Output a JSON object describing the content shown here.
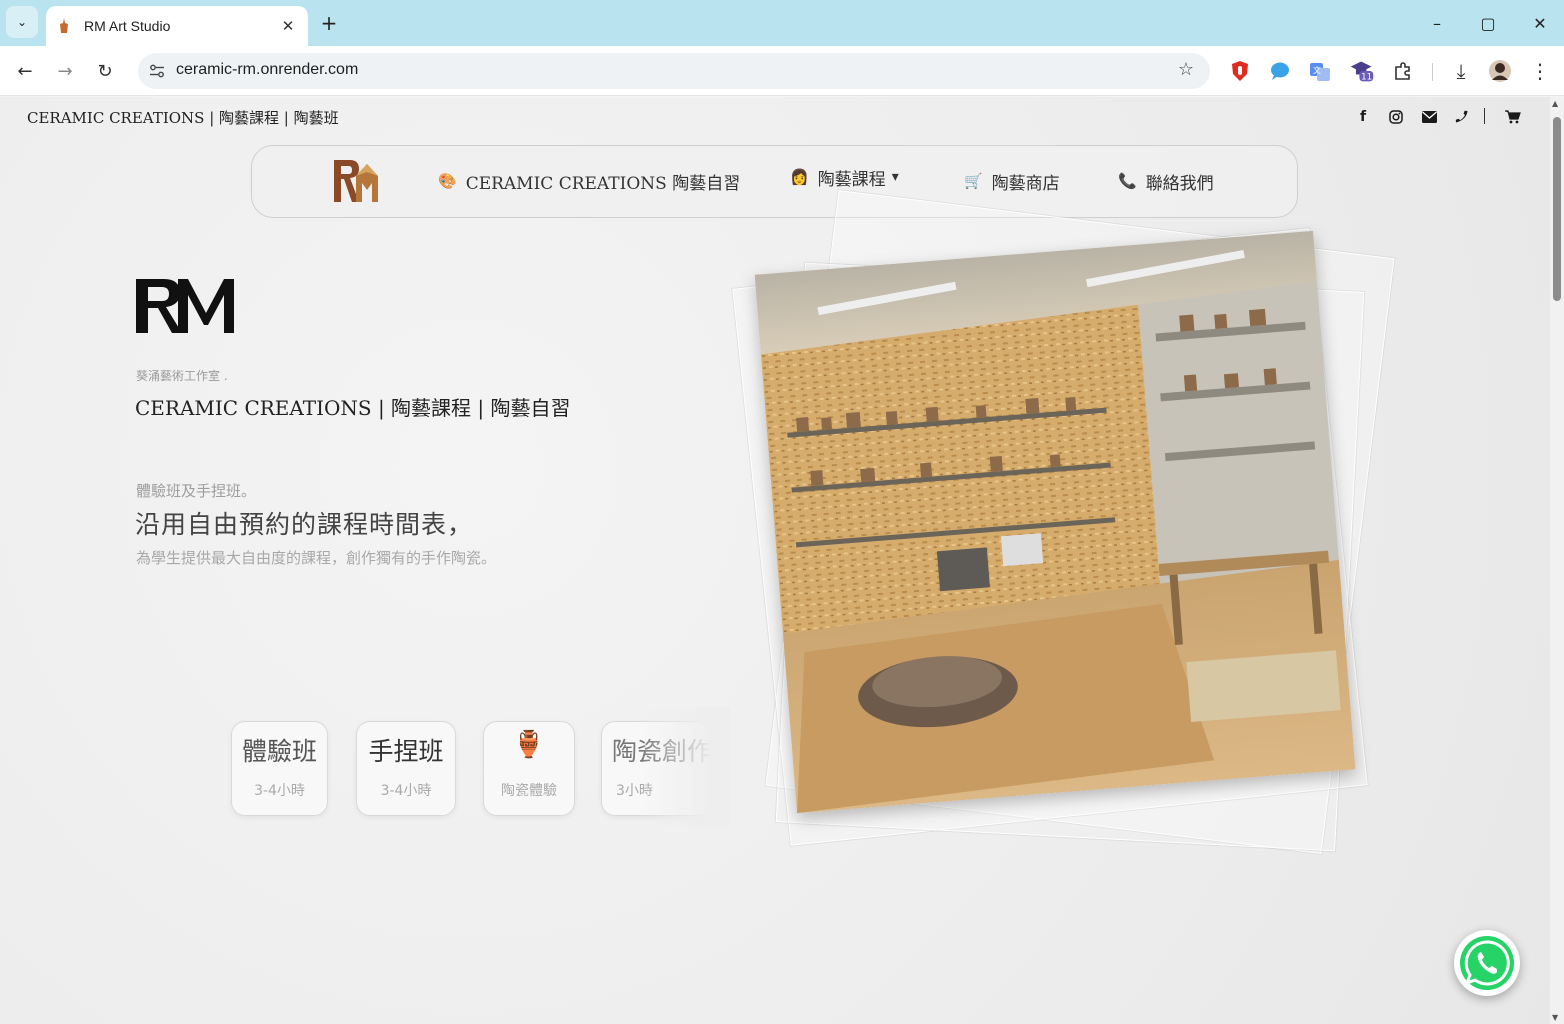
{
  "browser": {
    "tab": {
      "title": "RM Art Studio",
      "close": "✕"
    },
    "tab_list_icon": "⌄",
    "new_tab": "+",
    "window_controls": {
      "minimize": "–",
      "maximize": "▢",
      "close": "✕"
    },
    "nav": {
      "back": "←",
      "forward": "→",
      "reload": "↻"
    },
    "url": "ceramic-rm.onrender.com",
    "bookmark_star": "☆",
    "extensions": [
      {
        "name": "ublock-icon",
        "glyph": "⬢",
        "color": "#e02b20"
      },
      {
        "name": "chat-extension-icon",
        "glyph": "●",
        "color": "#3aa2e6"
      },
      {
        "name": "translate-extension-icon",
        "glyph": "文",
        "color": "#4a7fe0"
      },
      {
        "name": "graduation-extension-icon",
        "glyph": "🎓",
        "color": "#5a4fa0",
        "badge": "11"
      },
      {
        "name": "puzzle-extensions-icon",
        "glyph": "⧉",
        "color": "#333333"
      }
    ],
    "download_icon": "⤓",
    "menu_icon": "⋮"
  },
  "page": {
    "top_title": "CERAMIC CREATIONS | 陶藝課程 | 陶藝班",
    "social_icons": [
      {
        "name": "facebook-icon",
        "glyph": "f"
      },
      {
        "name": "instagram-icon",
        "glyph": "◎"
      },
      {
        "name": "mail-icon",
        "glyph": "✉"
      },
      {
        "name": "phone-icon",
        "glyph": "✆"
      }
    ],
    "cart_icon": "🛒",
    "navbar": {
      "logo_text": "RM",
      "items": [
        {
          "icon": "🎨",
          "label": "CERAMIC CREATIONS 陶藝自習"
        },
        {
          "icon": "👩",
          "label": "陶藝課程",
          "caret": "▾"
        },
        {
          "icon": "🛒",
          "label": "陶藝商店"
        },
        {
          "icon": "📞",
          "label": "聯絡我們"
        }
      ]
    },
    "hero": {
      "logo_text": "RM",
      "studio_name": "葵涌藝術工作室 .",
      "title": "CERAMIC CREATIONS | 陶藝課程 | 陶藝自習",
      "kicker": "體驗班及手捏班。",
      "heading": "沿用自由預約的課程時間表，",
      "description": "為學生提供最大自由度的課程，創作獨有的手作陶瓷。"
    },
    "course_cards": [
      {
        "title": "體驗班",
        "subtitle": "3-4小時"
      },
      {
        "title": "手捏班",
        "subtitle": "3-4小時"
      },
      {
        "icon": "🏺",
        "subtitle": "陶瓷體驗"
      },
      {
        "title": "陶瓷創作",
        "subtitle": "3小時"
      }
    ],
    "whatsapp_icon": "whatsapp"
  }
}
